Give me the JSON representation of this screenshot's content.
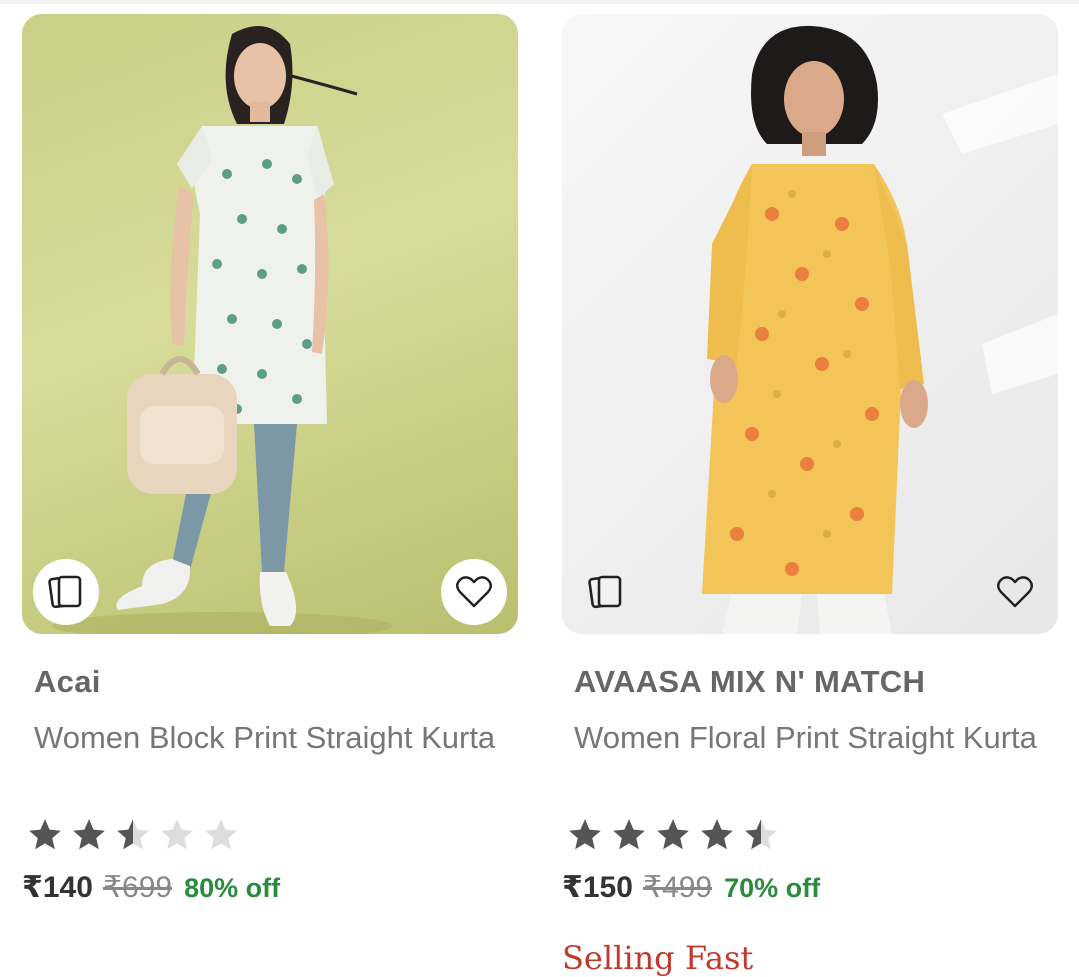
{
  "colors": {
    "price": "#333333",
    "mrp": "#888888",
    "discount": "#2a8a3e",
    "selling_fast": "#c0392b",
    "star_filled": "#555555",
    "star_empty": "#dddddd"
  },
  "products": [
    {
      "brand": "Acai",
      "title": "Women Block Print Straight Kurta",
      "rating": 2.5,
      "price": "₹140",
      "mrp": "₹699",
      "discount": "80% off",
      "badge": ""
    },
    {
      "brand": "AVAASA MIX N' MATCH",
      "title": "Women Floral Print Straight Kurta",
      "rating": 4.5,
      "price": "₹150",
      "mrp": "₹499",
      "discount": "70% off",
      "badge": "Selling Fast"
    }
  ],
  "icons": {
    "similar": "similar-products-icon",
    "wishlist": "heart-outline-icon"
  }
}
